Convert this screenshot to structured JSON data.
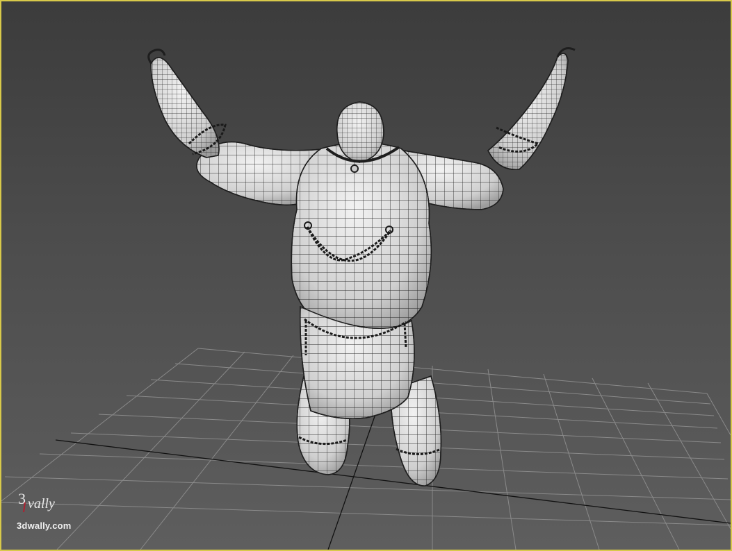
{
  "viewport": {
    "label": "3D perspective viewport",
    "border_color": "#d8c94a",
    "background_top": "#3c3c3c",
    "background_bottom": "#5e5e5e",
    "grid_color": "#8a8a8a",
    "axis_color": "#111111",
    "shading": "wireframe-on-shaded",
    "mesh_color": "#d9d9d9"
  },
  "watermark": {
    "logo_text": "3wally",
    "site": "3dwally.com"
  }
}
